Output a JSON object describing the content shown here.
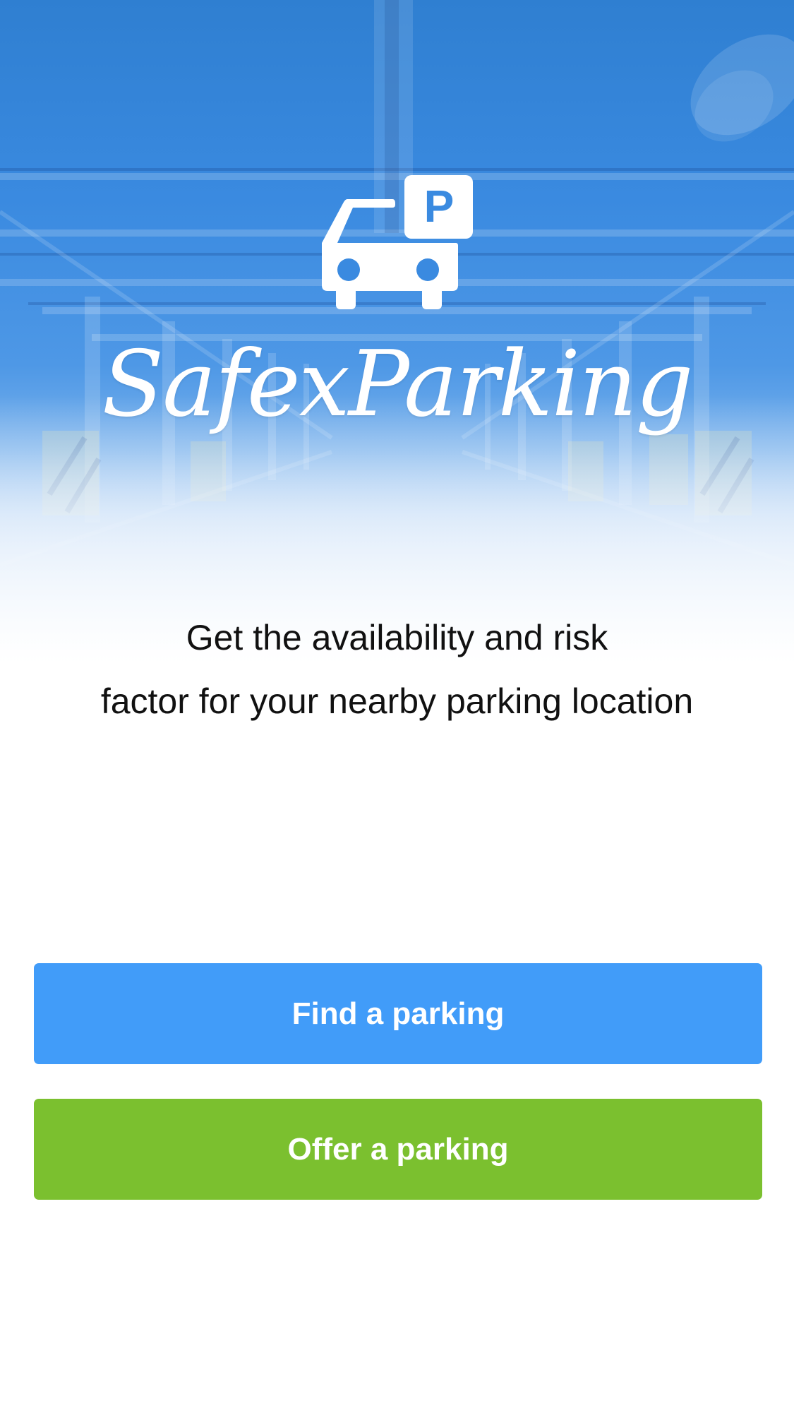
{
  "app": {
    "brand_name": "SafexParking",
    "logo_icon": "car-parking-icon",
    "logo_sign_letter": "P"
  },
  "tagline": {
    "line1": "Get the availability and risk",
    "line2": "factor for your nearby parking location"
  },
  "actions": {
    "find_label": "Find a parking",
    "offer_label": "Offer a parking"
  },
  "colors": {
    "hero_blue": "#3a8ae0",
    "find_button": "#419cf9",
    "offer_button": "#7bc02f",
    "text": "#111111"
  }
}
